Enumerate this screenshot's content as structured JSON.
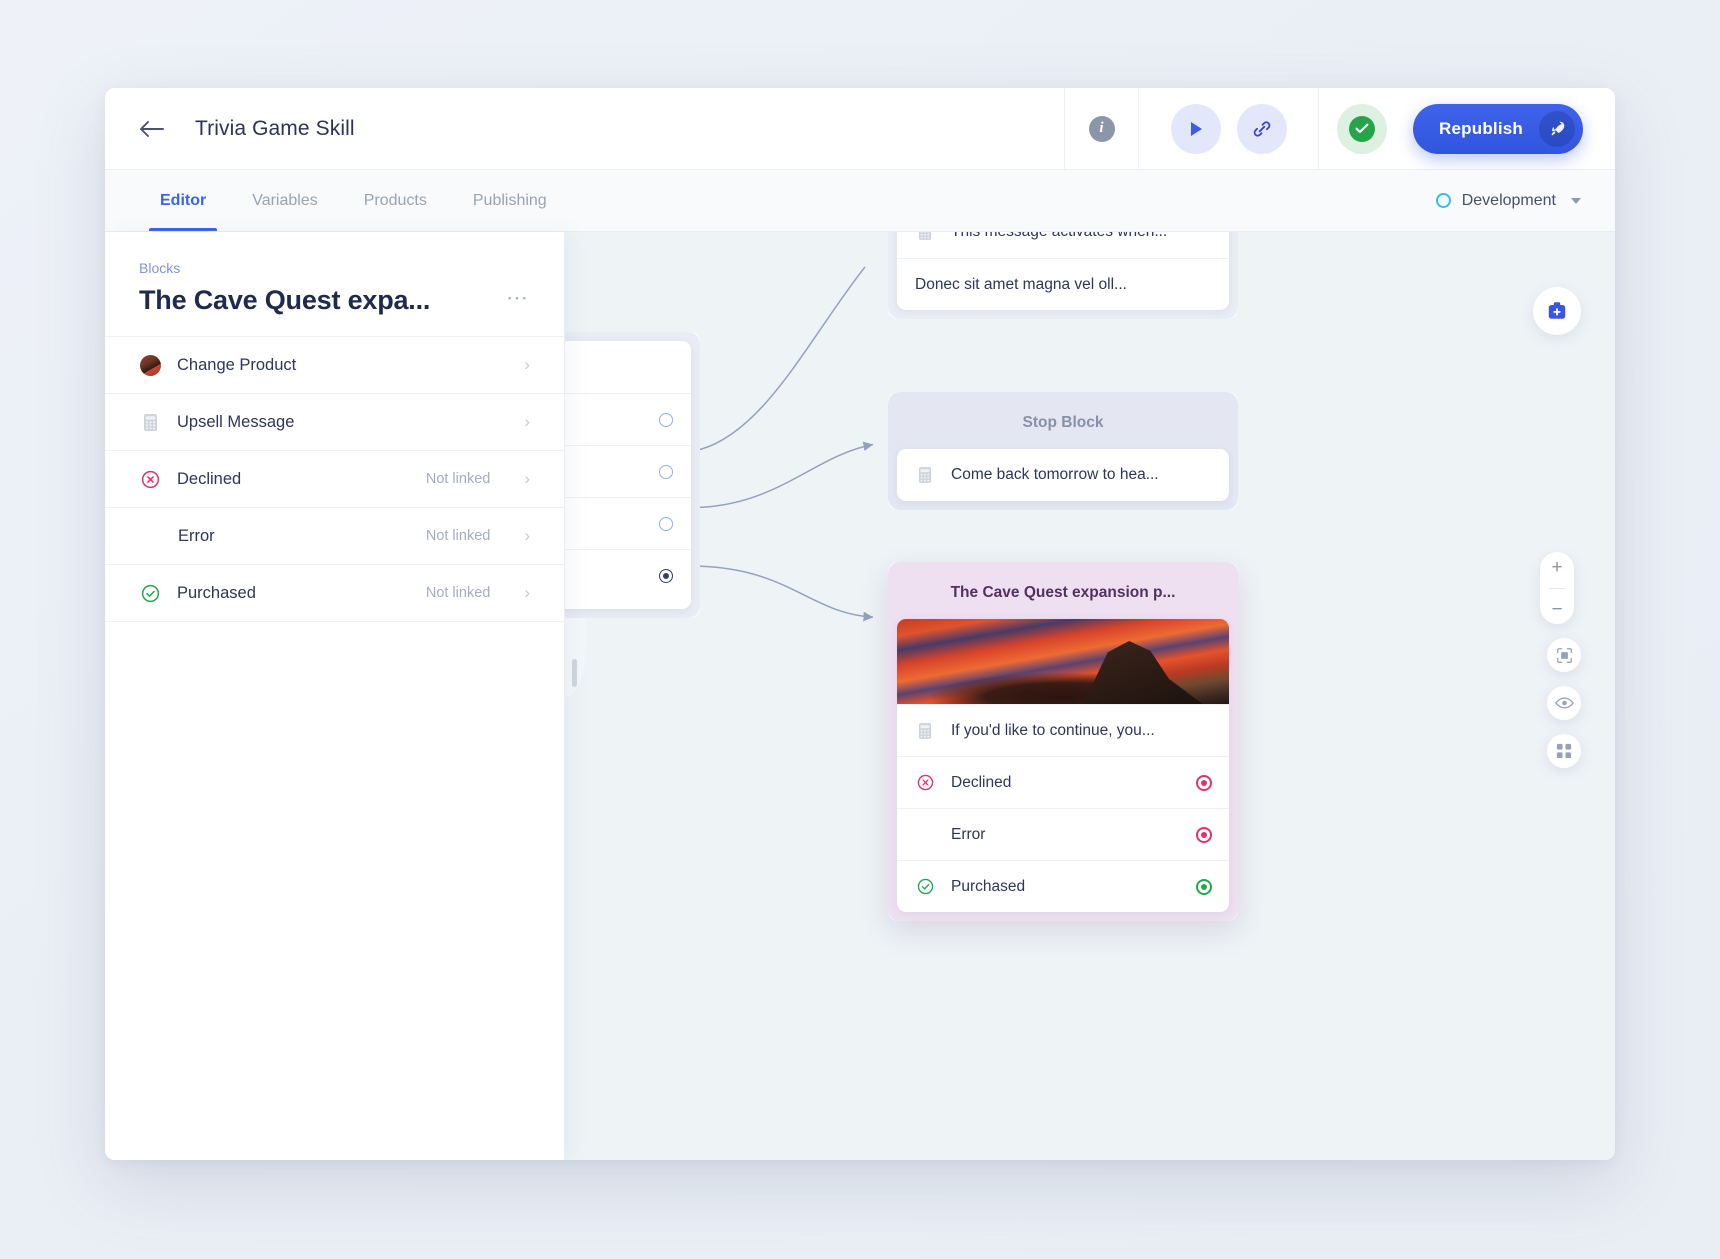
{
  "header": {
    "back_icon": "arrow-left-icon",
    "title": "Trivia Game Skill",
    "info_icon": "info-icon",
    "info_label": "i",
    "play_icon": "play-icon",
    "link_icon": "link-icon",
    "status_icon": "check-circle-icon",
    "republish_label": "Republish",
    "rocket_icon": "rocket-icon"
  },
  "tabs": [
    {
      "label": "Editor",
      "active": true
    },
    {
      "label": "Variables",
      "active": false
    },
    {
      "label": "Products",
      "active": false
    },
    {
      "label": "Publishing",
      "active": false
    }
  ],
  "environment": {
    "label": "Development",
    "ring_icon": "circle-outline-icon",
    "caret_icon": "chevron-down-icon"
  },
  "sidebar": {
    "breadcrumb": "Blocks",
    "title": "The Cave Quest expa...",
    "menu_icon": "ellipsis-icon",
    "rows": [
      {
        "label": "Change Product",
        "meta": "",
        "icon": "product-thumbnail-icon",
        "indent": false
      },
      {
        "label": "Upsell Message",
        "meta": "",
        "icon": "message-icon",
        "indent": false
      },
      {
        "label": "Declined",
        "meta": "Not linked",
        "icon": "declined-icon",
        "indent": false
      },
      {
        "label": "Error",
        "meta": "Not linked",
        "icon": "none",
        "indent": true
      },
      {
        "label": "Purchased",
        "meta": "Not linked",
        "icon": "purchased-icon",
        "indent": false
      }
    ],
    "chevron_icon": "chevron-right-icon"
  },
  "canvas": {
    "nodes": {
      "top_message_card": {
        "lines": [
          {
            "text": "This message activates when...",
            "icon": "message-icon"
          },
          {
            "text": "Donec sit amet magna vel oll...",
            "icon": "none"
          }
        ]
      },
      "stop_block": {
        "title": "Stop Block",
        "lines": [
          {
            "text": "Come back tomorrow to hea...",
            "icon": "message-icon"
          }
        ]
      },
      "cave_quest": {
        "title": "The Cave Quest expansion p...",
        "image_alt": "mountain-sunset-image",
        "lines": [
          {
            "text": "If you'd like to continue, you...",
            "icon": "message-icon",
            "port": "none"
          },
          {
            "text": "Declined",
            "icon": "declined-icon",
            "port": "declined"
          },
          {
            "text": "Error",
            "icon": "none",
            "port": "error"
          },
          {
            "text": "Purchased",
            "icon": "purchased-icon",
            "port": "purchased"
          }
        ]
      },
      "left_card": {
        "lines": [
          {
            "text": "!",
            "port": "none"
          },
          {
            "text": "",
            "port": "open"
          },
          {
            "text": "",
            "port": "open"
          },
          {
            "text": "",
            "port": "open"
          },
          {
            "text": "",
            "port": "filled"
          }
        ]
      }
    },
    "controls": {
      "add_block_icon": "add-block-icon",
      "zoom_in_label": "+",
      "zoom_out_label": "−",
      "fit_icon": "fit-to-screen-icon",
      "preview_icon": "eye-icon",
      "grid_icon": "grid-icon"
    }
  },
  "colors": {
    "accent": "#3b63ea",
    "declined": "#e0326b",
    "purchased": "#21a84c",
    "env_ring": "#3fb9e8",
    "selected_node": "#eee0f1"
  }
}
